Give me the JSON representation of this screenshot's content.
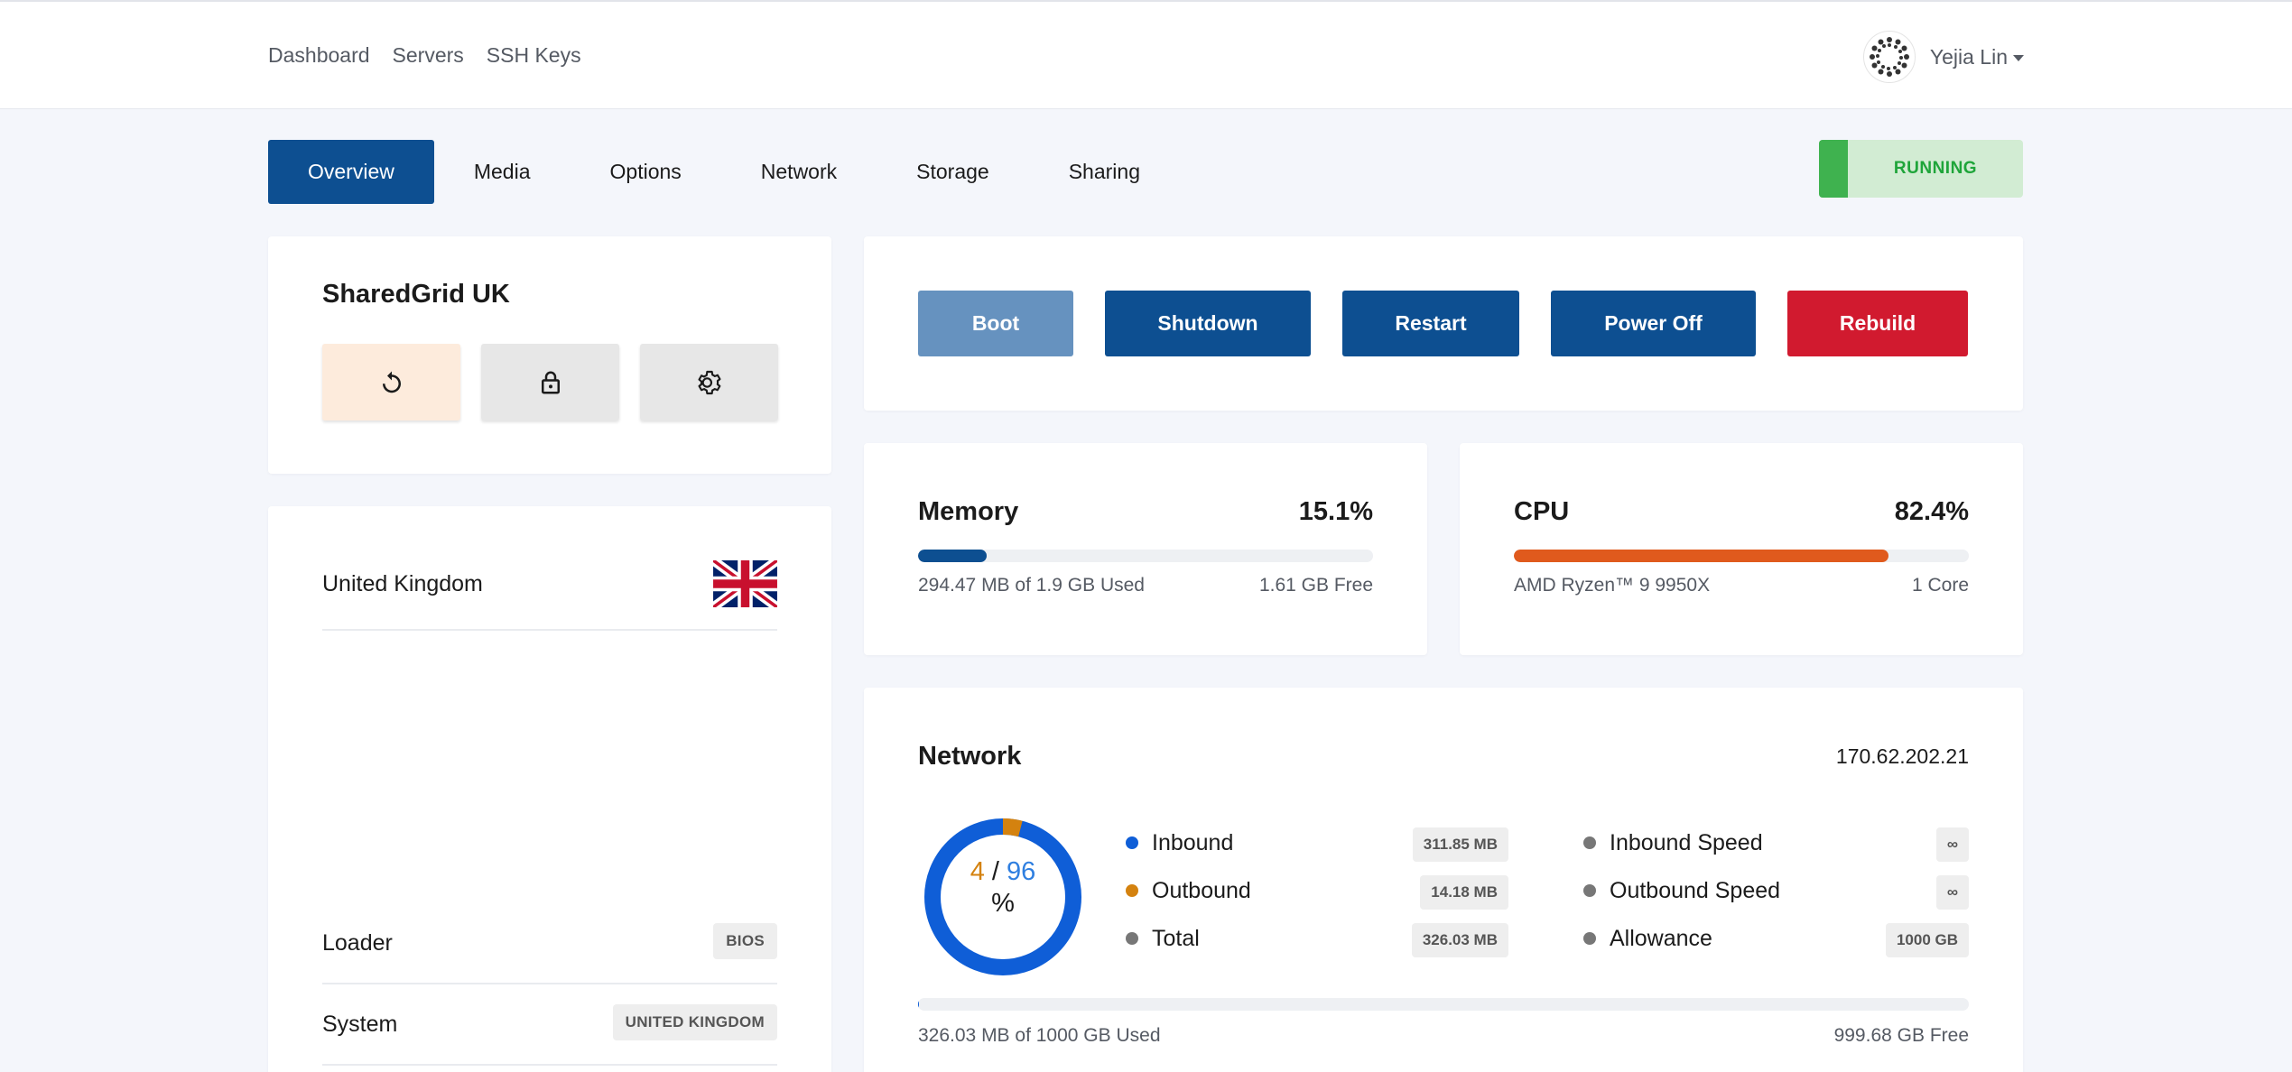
{
  "nav": {
    "links": [
      "Dashboard",
      "Servers",
      "SSH Keys"
    ],
    "user_name": "Yejia Lin"
  },
  "tabs": [
    "Overview",
    "Media",
    "Options",
    "Network",
    "Storage",
    "Sharing"
  ],
  "status": {
    "label": "RUNNING",
    "color": "#3fb24f"
  },
  "server": {
    "name": "SharedGrid UK",
    "quick_actions": [
      {
        "icon": "reinstall-icon",
        "bg": "#fdebdc"
      },
      {
        "icon": "lock-icon",
        "bg": "#e7e7e7"
      },
      {
        "icon": "gear-icon",
        "bg": "#e7e7e7"
      }
    ]
  },
  "info": {
    "location": "United Kingdom",
    "flag_icon": "uk-flag-icon",
    "loader_label": "Loader",
    "loader_value": "BIOS",
    "system_label": "System",
    "system_value": "UNITED KINGDOM"
  },
  "actions": {
    "boot": "Boot",
    "shutdown": "Shutdown",
    "restart": "Restart",
    "power_off": "Power Off",
    "rebuild": "Rebuild"
  },
  "memory": {
    "title": "Memory",
    "percent_label": "15.1%",
    "fraction": 0.151,
    "used_text": "294.47 MB of 1.9 GB Used",
    "free_text": "1.61 GB Free",
    "color": "#0d4f91"
  },
  "cpu": {
    "title": "CPU",
    "percent_label": "82.4%",
    "fraction": 0.824,
    "model": "AMD Ryzen™ 9 9950X",
    "cores": "1 Core",
    "color": "#e05a1d"
  },
  "network": {
    "title": "Network",
    "ip": "170.62.202.21",
    "donut": {
      "outbound_pct": "4",
      "inbound_pct": "96",
      "slash": "/",
      "percent_sign": "%",
      "outbound_fraction": 0.04,
      "outbound_color": "#d4820f",
      "inbound_color": "#0f5ed7"
    },
    "legend": [
      {
        "label": "Inbound",
        "value": "311.85 MB",
        "color": "#0f5ed7"
      },
      {
        "label": "Outbound",
        "value": "14.18 MB",
        "color": "#d4820f"
      },
      {
        "label": "Total",
        "value": "326.03 MB",
        "color": "#777777"
      }
    ],
    "speeds": [
      {
        "label": "Inbound Speed",
        "value": "∞",
        "color": "#777777"
      },
      {
        "label": "Outbound Speed",
        "value": "∞",
        "color": "#777777"
      },
      {
        "label": "Allowance",
        "value": "1000 GB",
        "color": "#777777"
      }
    ],
    "usage_fraction": 0.0003,
    "used_text": "326.03 MB of 1000 GB Used",
    "free_text": "999.68 GB Free"
  }
}
